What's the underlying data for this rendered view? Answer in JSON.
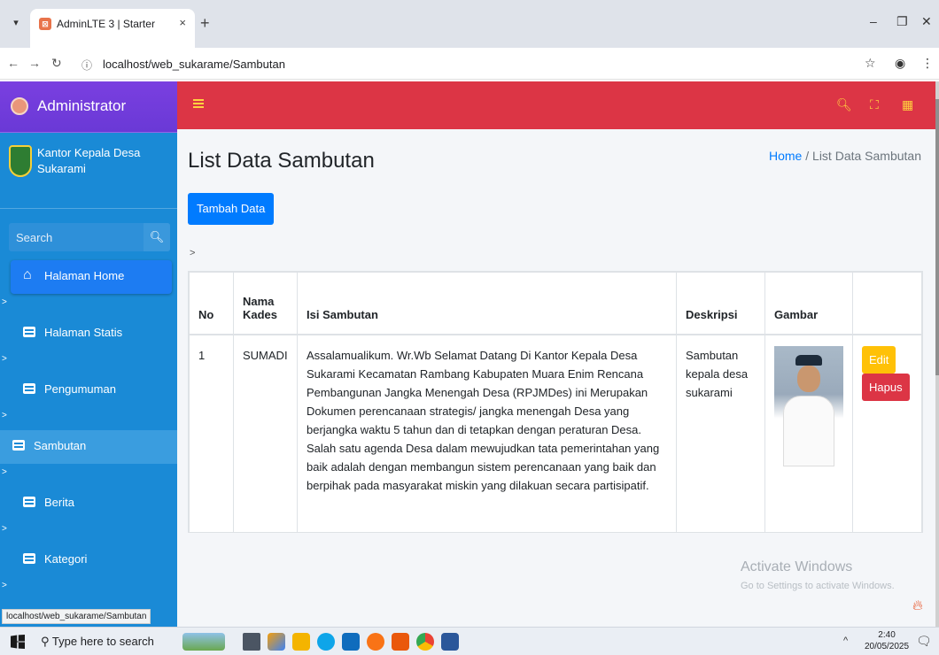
{
  "browser": {
    "tab_title": "AdminLTE 3 | Starter",
    "tab_close": "×",
    "new_tab": "+",
    "url": "localhost/web_sukarame/Sambutan",
    "status_url": "localhost/web_sukarame/Sambutan"
  },
  "sidebar": {
    "brand": "Administrator",
    "user_name": "Kantor Kepala Desa Sukarami",
    "search_placeholder": "Search",
    "items": [
      {
        "label": "Halaman Home"
      },
      {
        "label": "Halaman Statis"
      },
      {
        "label": "Pengumuman"
      },
      {
        "label": "Sambutan"
      },
      {
        "label": "Berita"
      },
      {
        "label": "Kategori"
      }
    ],
    "caret": ">"
  },
  "content": {
    "title": "List Data Sambutan",
    "breadcrumb_home": "Home",
    "breadcrumb_sep": "/",
    "breadcrumb_current": "List Data Sambutan",
    "add_button": "Tambah Data",
    "stray_text": ">"
  },
  "table": {
    "headers": [
      "No",
      "Nama Kades",
      "Isi Sambutan",
      "Deskripsi",
      "Gambar",
      ""
    ],
    "rows": [
      {
        "no": "1",
        "nama": "SUMADI",
        "isi": "Assalamualikum. Wr.Wb Selamat Datang Di Kantor Kepala Desa Sukarami Kecamatan Rambang Kabupaten Muara Enim Rencana Pembangunan Jangka Menengah Desa (RPJMDes) ini Merupakan Dokumen perencanaan strategis/ jangka menengah Desa yang berjangka waktu 5 tahun dan di tetapkan dengan peraturan Desa. Salah satu agenda Desa dalam mewujudkan tata pemerintahan yang baik adalah dengan membangun sistem perencanaan yang baik dan berpihak pada masyarakat miskin yang dilakuan secara partisipatif.",
        "deskripsi": "Sambutan kepala desa sukarami",
        "edit": "Edit",
        "hapus": "Hapus"
      }
    ]
  },
  "watermark": {
    "line1": "Activate Windows",
    "line2": "Go to Settings to activate Windows."
  },
  "taskbar": {
    "search": "Type here to search",
    "time": "2:40",
    "date": "20/05/2025"
  },
  "colors": {
    "sidebar": "#1a8ad6",
    "brand": "#6f42c1",
    "topnav": "#dc3545",
    "primary": "#007bff",
    "warning": "#ffc107",
    "danger": "#dc3545"
  }
}
